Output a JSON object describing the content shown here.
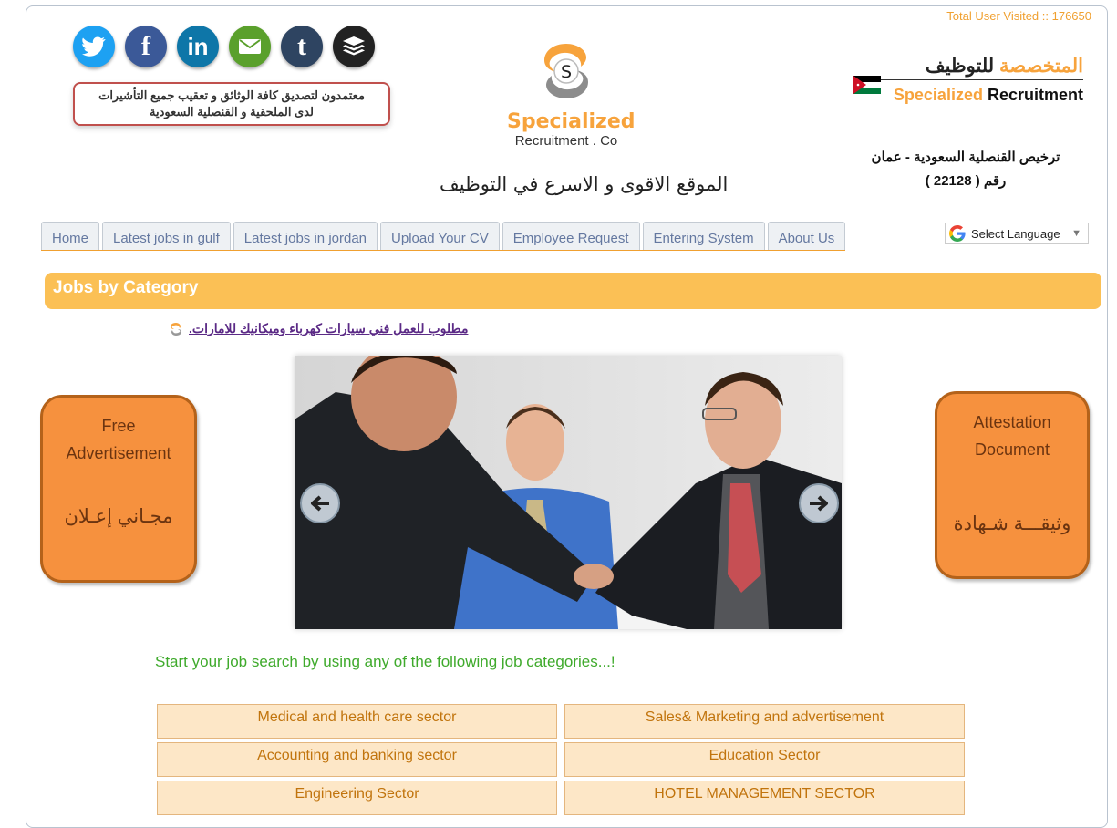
{
  "header": {
    "visits": "Total User Visited :: 176650",
    "attest_text_line1": "معتمدون لتصديق كافة الوثائق و تعقيب جميع التأشيرات",
    "attest_text_line2": "لدى الملحقية و القنصلية السعودية",
    "logo_name": "Specialized",
    "logo_sub": "Recruitment . Co",
    "tagline": "الموقع الاقوى و الاسرع في التوظيف",
    "brand_ar_orange": "المتخصصة",
    "brand_ar_black": "للتوظيف",
    "brand_en_orange": "Specialized",
    "brand_en_black": "Recruitment",
    "license_line1": "ترخيص القنصلية السعودية - عمان",
    "license_line2": "رقم ( 22128 )"
  },
  "social": [
    "twitter-icon",
    "facebook-icon",
    "linkedin-icon",
    "email-icon",
    "tumblr-icon",
    "buffer-icon"
  ],
  "nav": {
    "tabs": [
      "Home",
      "Latest jobs in gulf",
      "Latest jobs in jordan",
      "Upload Your CV",
      "Employee Request",
      "Entering System",
      "About Us"
    ]
  },
  "language": {
    "label": "Select Language"
  },
  "main": {
    "category_heading": "Jobs by Category",
    "job_link": "مطلوب للعمل فني سيارات كهرباء وميكانيك للامارات.",
    "left_card": {
      "en_line1": "Free",
      "en_line2": "Advertisement",
      "ar": "مجـاني إعـلان"
    },
    "right_card": {
      "en_line1": "Attestation",
      "en_line2": "Document",
      "ar": "وثيقـــة شـهادة"
    },
    "prompt": "Start your job search by using any of the following job categories...!",
    "categories": [
      "Medical and health care sector",
      "Sales& Marketing and advertisement",
      "Accounting and banking sector",
      "Education Sector",
      "Engineering Sector",
      "HOTEL MANAGEMENT SECTOR"
    ]
  },
  "colors": {
    "accent": "#f7a33c",
    "card": "#f6913e",
    "heading_bar": "#fbc055",
    "prompt": "#3faa2c"
  }
}
